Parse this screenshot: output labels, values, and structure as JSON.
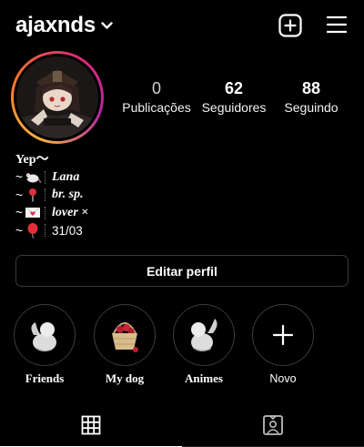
{
  "header": {
    "username": "ajaxnds",
    "icons": [
      "chevron-down-icon",
      "new-post-icon",
      "hamburger-menu-icon"
    ]
  },
  "stats": [
    {
      "value": "0",
      "label": "Publicações"
    },
    {
      "value": "62",
      "label": "Seguidores"
    },
    {
      "value": "88",
      "label": "Seguindo"
    }
  ],
  "bio": {
    "name": "Yep〜",
    "lines": [
      {
        "prefix": "~",
        "emoji": "rat-icon",
        "text": "Lana"
      },
      {
        "prefix": "~",
        "emoji": "pushpin-icon",
        "text": "br. sp."
      },
      {
        "prefix": "~",
        "emoji": "love-letter-icon",
        "text": "lover ×"
      },
      {
        "prefix": "~",
        "emoji": "balloon-icon",
        "text": "31/03"
      }
    ]
  },
  "edit_profile_label": "Editar perfil",
  "highlights": [
    {
      "label": "Friends"
    },
    {
      "label": "My dog"
    },
    {
      "label": "Animes"
    },
    {
      "label": "Novo"
    }
  ],
  "tabs": [
    "grid-icon",
    "tagged-icon"
  ],
  "colors": {
    "background": "#000000",
    "text": "#ffffff",
    "ring_gradient": [
      "#f5b342",
      "#f7772b",
      "#e02b72",
      "#b425a0"
    ],
    "border": "#3a3a3a"
  }
}
